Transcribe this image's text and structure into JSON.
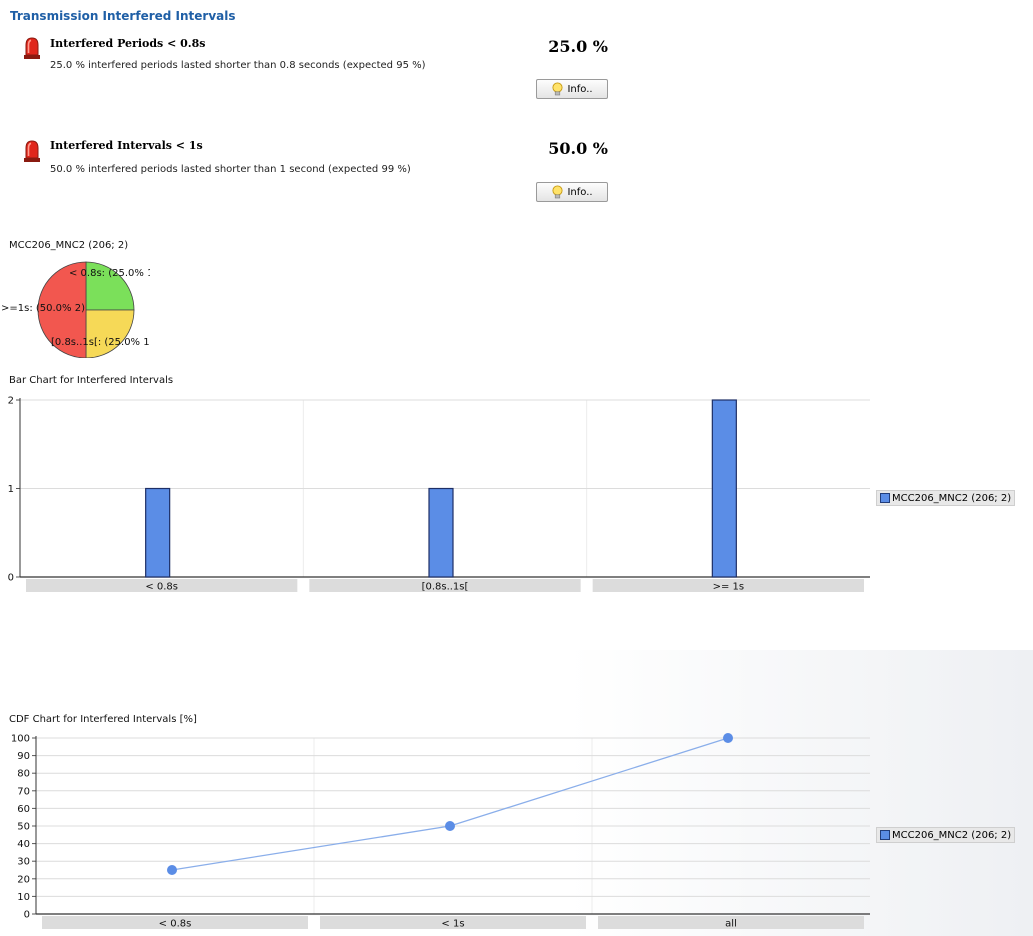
{
  "section_title": "Transmission Interfered Intervals",
  "kpis": [
    {
      "title": "Interfered Periods < 0.8s",
      "description": "25.0 % interfered periods lasted shorter than 0.8 seconds (expected 95 %)",
      "value": "25.0 %",
      "info_label": "Info..",
      "icon": "red-alarm-icon"
    },
    {
      "title": "Interfered Intervals < 1s",
      "description": "50.0 % interfered periods lasted shorter than 1 second (expected 99 %)",
      "value": "50.0 %",
      "info_label": "Info..",
      "icon": "red-alarm-icon"
    }
  ],
  "pie": {
    "title": "MCC206_MNC2 (206; 2)",
    "slice_labels": [
      "< 0.8s: (25.0% 1)",
      "[0.8s..1s[: (25.0% 1)",
      ">=1s: (50.0% 2)"
    ]
  },
  "bar": {
    "title": "Bar Chart for Interfered Intervals",
    "legend": "MCC206_MNC2 (206; 2)"
  },
  "cdf": {
    "title": "CDF Chart for Interfered Intervals [%]",
    "legend": "MCC206_MNC2 (206; 2)"
  },
  "colors": {
    "title_blue": "#1f5fa6",
    "series_blue": "#5b8de6",
    "pie_green": "#7be05a",
    "pie_yellow": "#f6d957",
    "pie_red": "#f2574f"
  },
  "chart_data": [
    {
      "type": "pie",
      "title": "MCC206_MNC2 (206; 2)",
      "categories": [
        "< 0.8s",
        "[0.8s..1s[",
        ">=1s"
      ],
      "values": [
        1,
        1,
        2
      ],
      "percents": [
        25.0,
        25.0,
        50.0
      ]
    },
    {
      "type": "bar",
      "title": "Bar Chart for Interfered Intervals",
      "categories": [
        "< 0.8s",
        "[0.8s..1s[",
        ">= 1s"
      ],
      "series": [
        {
          "name": "MCC206_MNC2 (206; 2)",
          "values": [
            1,
            1,
            2
          ]
        }
      ],
      "ylim": [
        0,
        2
      ],
      "yticks": [
        "0",
        "1",
        "2"
      ],
      "grid": true,
      "legend_position": "right"
    },
    {
      "type": "line",
      "title": "CDF Chart for Interfered Intervals [%]",
      "categories": [
        "< 0.8s",
        "< 1s",
        "all"
      ],
      "series": [
        {
          "name": "MCC206_MNC2 (206; 2)",
          "values": [
            25,
            50,
            100
          ]
        }
      ],
      "ylim": [
        0,
        100
      ],
      "yticks": [
        "0",
        "10",
        "20",
        "30",
        "40",
        "50",
        "60",
        "70",
        "80",
        "90",
        "100"
      ],
      "grid": true,
      "legend_position": "right"
    }
  ]
}
